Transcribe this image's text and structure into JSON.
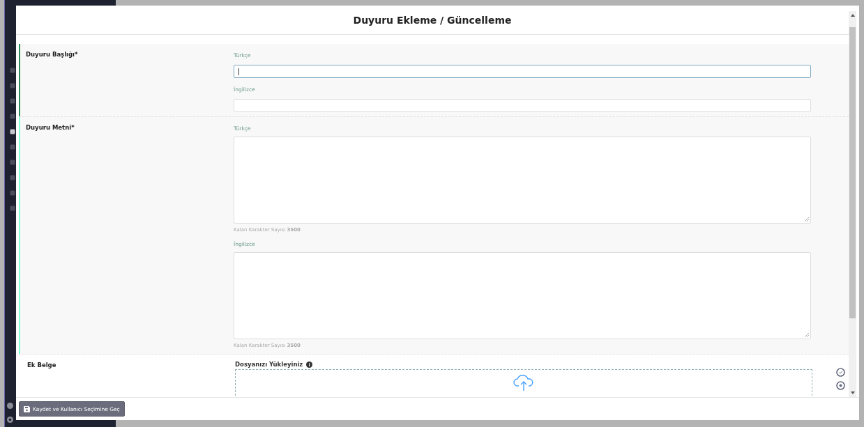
{
  "modal": {
    "title": "Duyuru Ekleme / Güncelleme"
  },
  "sections": [
    {
      "label": "Duyuru Başlığı*",
      "color": "#2e8b57",
      "fields": [
        {
          "kind": "input",
          "language": "Türkçe",
          "focused": true
        },
        {
          "kind": "input",
          "language": "İngilizce",
          "focused": false
        }
      ]
    },
    {
      "label": "Duyuru Metni*",
      "color": "#7fffd4",
      "fields": [
        {
          "kind": "textarea",
          "language": "Türkçe",
          "counter": "Kalan Karakter Sayısı **3500**"
        },
        {
          "kind": "textarea",
          "language": "İngilizce",
          "counter": "Kalan Karakter Sayısı **3500**"
        }
      ]
    }
  ],
  "attachment": {
    "label": "Ek Belge",
    "upload_label": "Dosyanızı Yükleyiniz"
  },
  "save_button": {
    "label": "Kaydet ve Kullanıcı Seçimine Geç"
  }
}
